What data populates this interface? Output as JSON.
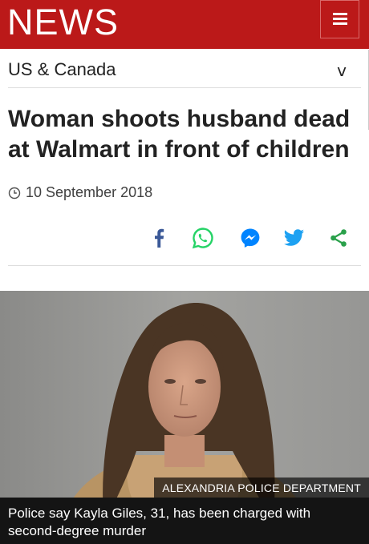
{
  "header": {
    "logo_text": "NEWS",
    "brand_color": "#bb1919",
    "menu_icon": "hamburger-menu-icon"
  },
  "section": {
    "title": "US & Canada",
    "toggle_glyph": "v"
  },
  "article": {
    "headline": "Woman shoots husband dead at Walmart in front of children",
    "date": "10 September 2018",
    "share_icons": [
      "facebook-icon",
      "whatsapp-icon",
      "messenger-icon",
      "twitter-icon",
      "share-icon"
    ]
  },
  "image": {
    "credit": "ALEXANDRIA POLICE DEPARTMENT",
    "caption": "Police say Kayla Giles, 31, has been charged with second-degree murder"
  },
  "colors": {
    "facebook": "#3b5998",
    "whatsapp": "#25d366",
    "messenger": "#0084ff",
    "twitter": "#1da1f2",
    "share": "#2aa14b"
  }
}
